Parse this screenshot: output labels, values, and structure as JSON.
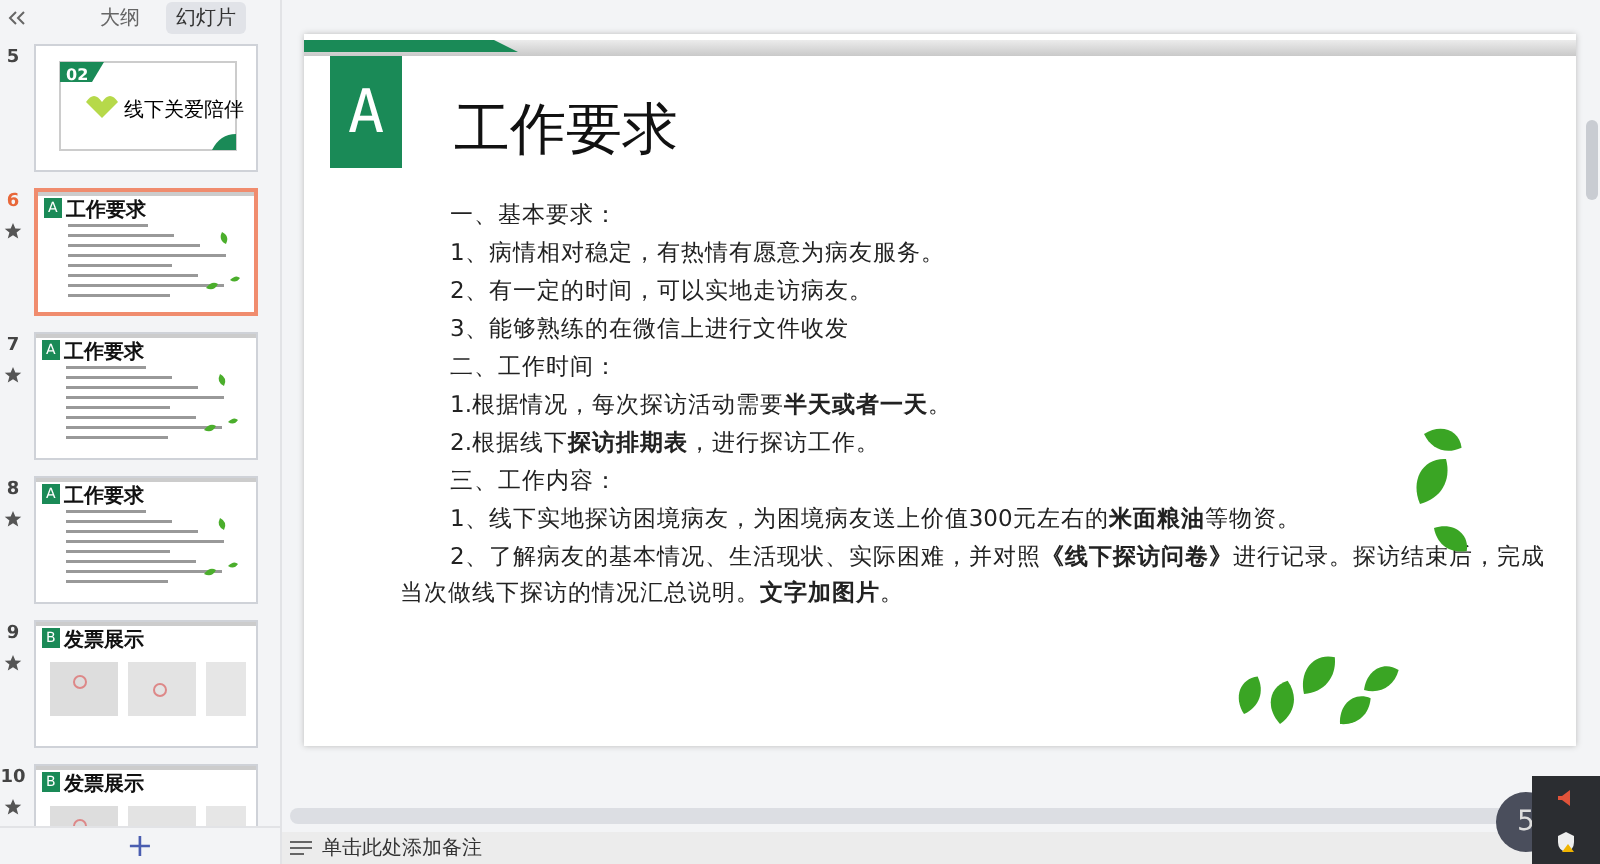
{
  "sidebar": {
    "tabs": [
      {
        "label": "大纲",
        "selected": false
      },
      {
        "label": "幻灯片",
        "selected": true
      }
    ],
    "slides": [
      {
        "number": "5",
        "kind": "section",
        "badge": "02",
        "title": "线下关爱陪伴",
        "selected": false,
        "animated": false
      },
      {
        "number": "6",
        "kind": "text",
        "badge": "A",
        "title": "工作要求",
        "selected": true,
        "animated": true
      },
      {
        "number": "7",
        "kind": "text",
        "badge": "A",
        "title": "工作要求",
        "selected": false,
        "animated": true
      },
      {
        "number": "8",
        "kind": "text",
        "badge": "A",
        "title": "工作要求",
        "selected": false,
        "animated": true
      },
      {
        "number": "9",
        "kind": "photos",
        "badge": "B",
        "title": "发票展示",
        "selected": false,
        "animated": true
      },
      {
        "number": "10",
        "kind": "photos",
        "badge": "B",
        "title": "发票展示",
        "selected": false,
        "animated": true
      }
    ],
    "add_button": "+"
  },
  "slide": {
    "badge": "A",
    "title": "工作要求",
    "paragraphs": [
      "一、基本要求：",
      "1、病情相对稳定，有热情有愿意为病友服务。",
      "2、有一定的时间，可以实地走访病友。",
      "3、能够熟练的在微信上进行文件收发",
      "二、工作时间：",
      "1.根据情况，每次探访活动需要**半天或者一天**。",
      "2.根据线下**探访排期表**，进行探访工作。",
      "三、工作内容：",
      "1、线下实地探访困境病友，为困境病友送上价值300元左右的**米面粮油**等物资。",
      "2、了解病友的基本情况、生活现状、实际困难，并对照**《线下探访问卷》**进行记录。探访结束后，完成当次做线下探访的情况汇总说明。**文字加图片**。"
    ]
  },
  "notes": {
    "placeholder": "单击此处添加备注"
  },
  "tray": {
    "badge": "5"
  }
}
